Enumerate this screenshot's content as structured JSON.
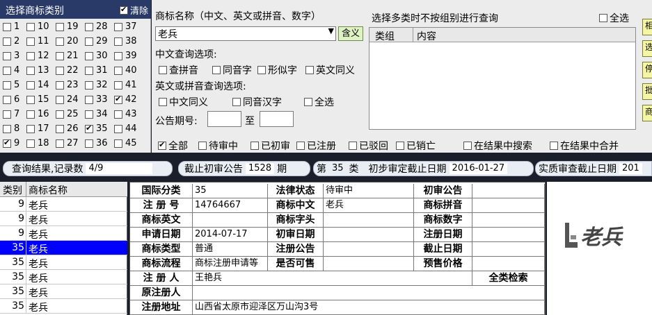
{
  "categories": {
    "title": "选择商标类别",
    "clear_label": "清除",
    "clear_checked": true,
    "columns": [
      [
        {
          "n": "1",
          "c": false
        },
        {
          "n": "2",
          "c": false
        },
        {
          "n": "3",
          "c": false
        },
        {
          "n": "4",
          "c": false
        },
        {
          "n": "5",
          "c": false
        },
        {
          "n": "6",
          "c": false
        },
        {
          "n": "7",
          "c": false
        },
        {
          "n": "8",
          "c": false
        },
        {
          "n": "9",
          "c": true
        }
      ],
      [
        {
          "n": "10",
          "c": false
        },
        {
          "n": "11",
          "c": false
        },
        {
          "n": "12",
          "c": false
        },
        {
          "n": "13",
          "c": false
        },
        {
          "n": "14",
          "c": false
        },
        {
          "n": "15",
          "c": false
        },
        {
          "n": "16",
          "c": false
        },
        {
          "n": "17",
          "c": false
        },
        {
          "n": "18",
          "c": false
        }
      ],
      [
        {
          "n": "19",
          "c": false
        },
        {
          "n": "20",
          "c": false
        },
        {
          "n": "21",
          "c": false
        },
        {
          "n": "22",
          "c": false
        },
        {
          "n": "23",
          "c": false
        },
        {
          "n": "24",
          "c": false
        },
        {
          "n": "25",
          "c": false
        },
        {
          "n": "26",
          "c": false
        },
        {
          "n": "27",
          "c": false
        }
      ],
      [
        {
          "n": "28",
          "c": false
        },
        {
          "n": "29",
          "c": false
        },
        {
          "n": "30",
          "c": false
        },
        {
          "n": "31",
          "c": false
        },
        {
          "n": "32",
          "c": false
        },
        {
          "n": "33",
          "c": false
        },
        {
          "n": "34",
          "c": false
        },
        {
          "n": "35",
          "c": true
        },
        {
          "n": "36",
          "c": false
        }
      ],
      [
        {
          "n": "37",
          "c": false
        },
        {
          "n": "38",
          "c": false
        },
        {
          "n": "39",
          "c": false
        },
        {
          "n": "40",
          "c": false
        },
        {
          "n": "41",
          "c": false
        },
        {
          "n": "42",
          "c": true
        },
        {
          "n": "43",
          "c": false
        },
        {
          "n": "44",
          "c": false
        },
        {
          "n": "45",
          "c": false
        }
      ]
    ]
  },
  "search": {
    "name_label": "商标名称（中文、英文或拼音、数字）",
    "name_value": "老兵",
    "hanyi_button": "含义",
    "cn_options_label": "中文查询选项:",
    "cn_options": [
      {
        "label": "查拼音",
        "c": false
      },
      {
        "label": "同音字",
        "c": false
      },
      {
        "label": "形似字",
        "c": false
      },
      {
        "label": "英文同义",
        "c": false
      }
    ],
    "en_options_label": "英文或拼音查询选项:",
    "en_options": [
      {
        "label": "中文同义",
        "c": false
      },
      {
        "label": "同音汉字",
        "c": false
      },
      {
        "label": "全选",
        "c": false
      }
    ],
    "announce_label": "公告期号:",
    "to_label": "至"
  },
  "multi": {
    "label": "选择多类时不按组别进行查询",
    "select_all": "全选",
    "col_group": "类组",
    "col_content": "内容"
  },
  "side_buttons": [
    "相",
    "选",
    "停",
    "批",
    "商"
  ],
  "filters": [
    {
      "label": "全部",
      "c": true
    },
    {
      "label": "待审中",
      "c": false
    },
    {
      "label": "已初审",
      "c": false
    },
    {
      "label": "已注册",
      "c": false
    },
    {
      "label": "已驳回",
      "c": false
    },
    {
      "label": "已销亡",
      "c": false
    },
    {
      "label": "在结果中搜索",
      "c": false
    },
    {
      "label": "在结果中合并",
      "c": false
    }
  ],
  "status": {
    "result_label": "查询结果,记录数",
    "result_value": "4/9",
    "deadline_label": "截止初审公告",
    "deadline_value": "1528",
    "deadline_unit": "期",
    "class_prefix": "第",
    "class_value": "35",
    "class_suffix": "类",
    "prelim_label": "初步审定截止日期",
    "prelim_value": "2016-01-27",
    "subst_label": "实质审查截止日期",
    "subst_value": "201"
  },
  "result_list": {
    "col_class": "类别",
    "col_name": "商标名称",
    "rows": [
      {
        "n": "9",
        "t": "老兵"
      },
      {
        "n": "9",
        "t": "老兵"
      },
      {
        "n": "9",
        "t": "老兵"
      },
      {
        "n": "35",
        "t": "老兵"
      },
      {
        "n": "35",
        "t": "老兵"
      },
      {
        "n": "35",
        "t": "老兵"
      },
      {
        "n": "35",
        "t": "老兵"
      },
      {
        "n": "35",
        "t": "老兵"
      }
    ],
    "selected_index": 3
  },
  "detail": {
    "intl_class_k": "国际分类",
    "intl_class_v": "35",
    "legal_k": "法律状态",
    "legal_v": "待审中",
    "prelim_k": "初审公告",
    "prelim_v": "",
    "regno_k": "注 册 号",
    "regno_v": "14764667",
    "cn_k": "商标中文",
    "cn_v": "老兵",
    "py_k": "商标拼音",
    "py_v": "",
    "en_k": "商标英文",
    "en_v": "",
    "head_k": "商标字头",
    "head_v": "",
    "num_k": "商标数字",
    "num_v": "",
    "apply_k": "申请日期",
    "apply_v": "2014-07-17",
    "prelim_date_k": "初审日期",
    "prelim_date_v": "",
    "reg_date_k": "注册日期",
    "reg_date_v": "",
    "type_k": "商标类型",
    "type_v": "普通",
    "reg_ann_k": "注册公告",
    "reg_ann_v": "",
    "end_date_k": "截止日期",
    "end_date_v": "",
    "flow_k": "商标流程",
    "flow_v": "商标注册申请等",
    "sellable_k": "是否可售",
    "sellable_v": "",
    "presale_k": "预售价格",
    "presale_v": "",
    "registrant_k": "注 册 人",
    "registrant_v": "王艳兵",
    "all_class_search": "全类检索",
    "orig_registrant_k": "原注册人",
    "orig_registrant_v": "",
    "address_k": "注册地址",
    "address_v": "山西省太原市迎泽区万山沟3号"
  },
  "logo_text": "老兵"
}
